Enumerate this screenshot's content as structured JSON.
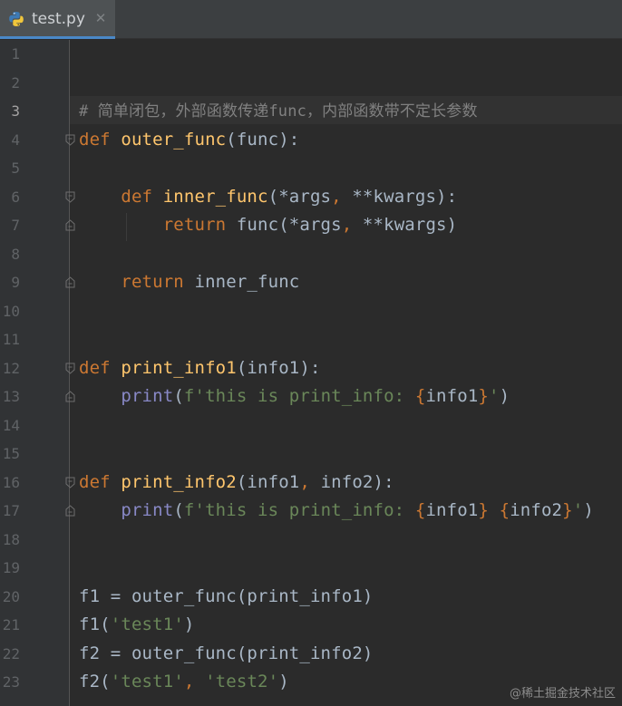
{
  "tab": {
    "file_name": "test.py",
    "icon": "python-file-icon",
    "close_glyph": "✕"
  },
  "colors": {
    "background": "#2b2b2b",
    "gutter": "#313335",
    "keyword": "#cc7832",
    "function_name": "#ffc66d",
    "string": "#6a8759",
    "builtin": "#8888c6",
    "comment": "#808080",
    "default_text": "#a9b7c6"
  },
  "current_line": 3,
  "lines": [
    {
      "n": "1",
      "tokens": []
    },
    {
      "n": "2",
      "tokens": []
    },
    {
      "n": "3",
      "tokens": [
        [
          "c",
          "# 简单闭包，外部函数传递func，内部函数带不定长参数"
        ]
      ]
    },
    {
      "n": "4",
      "tokens": [
        [
          "k",
          "def "
        ],
        [
          "f",
          "outer_func"
        ],
        [
          "p",
          "(func):"
        ]
      ]
    },
    {
      "n": "5",
      "tokens": []
    },
    {
      "n": "6",
      "tokens": [
        [
          "p",
          "    "
        ],
        [
          "k",
          "def "
        ],
        [
          "f",
          "inner_func"
        ],
        [
          "p",
          "(*args"
        ],
        [
          "k",
          ", "
        ],
        [
          "p",
          "**kwargs):"
        ]
      ]
    },
    {
      "n": "7",
      "tokens": [
        [
          "p",
          "        "
        ],
        [
          "k",
          "return "
        ],
        [
          "p",
          "func(*args"
        ],
        [
          "k",
          ", "
        ],
        [
          "p",
          "**kwargs)"
        ]
      ]
    },
    {
      "n": "8",
      "tokens": []
    },
    {
      "n": "9",
      "tokens": [
        [
          "p",
          "    "
        ],
        [
          "k",
          "return "
        ],
        [
          "p",
          "inner_func"
        ]
      ]
    },
    {
      "n": "10",
      "tokens": []
    },
    {
      "n": "11",
      "tokens": []
    },
    {
      "n": "12",
      "tokens": [
        [
          "k",
          "def "
        ],
        [
          "f",
          "print_info1"
        ],
        [
          "p",
          "(info1):"
        ]
      ]
    },
    {
      "n": "13",
      "tokens": [
        [
          "p",
          "    "
        ],
        [
          "b",
          "print"
        ],
        [
          "p",
          "("
        ],
        [
          "s",
          "f'this is print_info: "
        ],
        [
          "k",
          "{"
        ],
        [
          "p",
          "info1"
        ],
        [
          "k",
          "}"
        ],
        [
          "s",
          "'"
        ],
        [
          "p",
          ")"
        ]
      ]
    },
    {
      "n": "14",
      "tokens": []
    },
    {
      "n": "15",
      "tokens": []
    },
    {
      "n": "16",
      "tokens": [
        [
          "k",
          "def "
        ],
        [
          "f",
          "print_info2"
        ],
        [
          "p",
          "(info1"
        ],
        [
          "k",
          ", "
        ],
        [
          "p",
          "info2):"
        ]
      ]
    },
    {
      "n": "17",
      "tokens": [
        [
          "p",
          "    "
        ],
        [
          "b",
          "print"
        ],
        [
          "p",
          "("
        ],
        [
          "s",
          "f'this is print_info: "
        ],
        [
          "k",
          "{"
        ],
        [
          "p",
          "info1"
        ],
        [
          "k",
          "}"
        ],
        [
          "s",
          " "
        ],
        [
          "k",
          "{"
        ],
        [
          "p",
          "info2"
        ],
        [
          "k",
          "}"
        ],
        [
          "s",
          "'"
        ],
        [
          "p",
          ")"
        ]
      ]
    },
    {
      "n": "18",
      "tokens": []
    },
    {
      "n": "19",
      "tokens": []
    },
    {
      "n": "20",
      "tokens": [
        [
          "p",
          "f1 = outer_func(print_info1)"
        ]
      ]
    },
    {
      "n": "21",
      "tokens": [
        [
          "p",
          "f1("
        ],
        [
          "s",
          "'test1'"
        ],
        [
          "p",
          ")"
        ]
      ]
    },
    {
      "n": "22",
      "tokens": [
        [
          "p",
          "f2 = outer_func(print_info2)"
        ]
      ]
    },
    {
      "n": "23",
      "tokens": [
        [
          "p",
          "f2("
        ],
        [
          "s",
          "'test1'"
        ],
        [
          "k",
          ", "
        ],
        [
          "s",
          "'test2'"
        ],
        [
          "p",
          ")"
        ]
      ]
    }
  ],
  "fold_markers": [
    {
      "line": 4,
      "kind": "open"
    },
    {
      "line": 6,
      "kind": "open"
    },
    {
      "line": 7,
      "kind": "close"
    },
    {
      "line": 9,
      "kind": "close"
    },
    {
      "line": 12,
      "kind": "open"
    },
    {
      "line": 13,
      "kind": "close"
    },
    {
      "line": 16,
      "kind": "open"
    },
    {
      "line": 17,
      "kind": "close"
    }
  ],
  "watermark": "@稀土掘金技术社区"
}
